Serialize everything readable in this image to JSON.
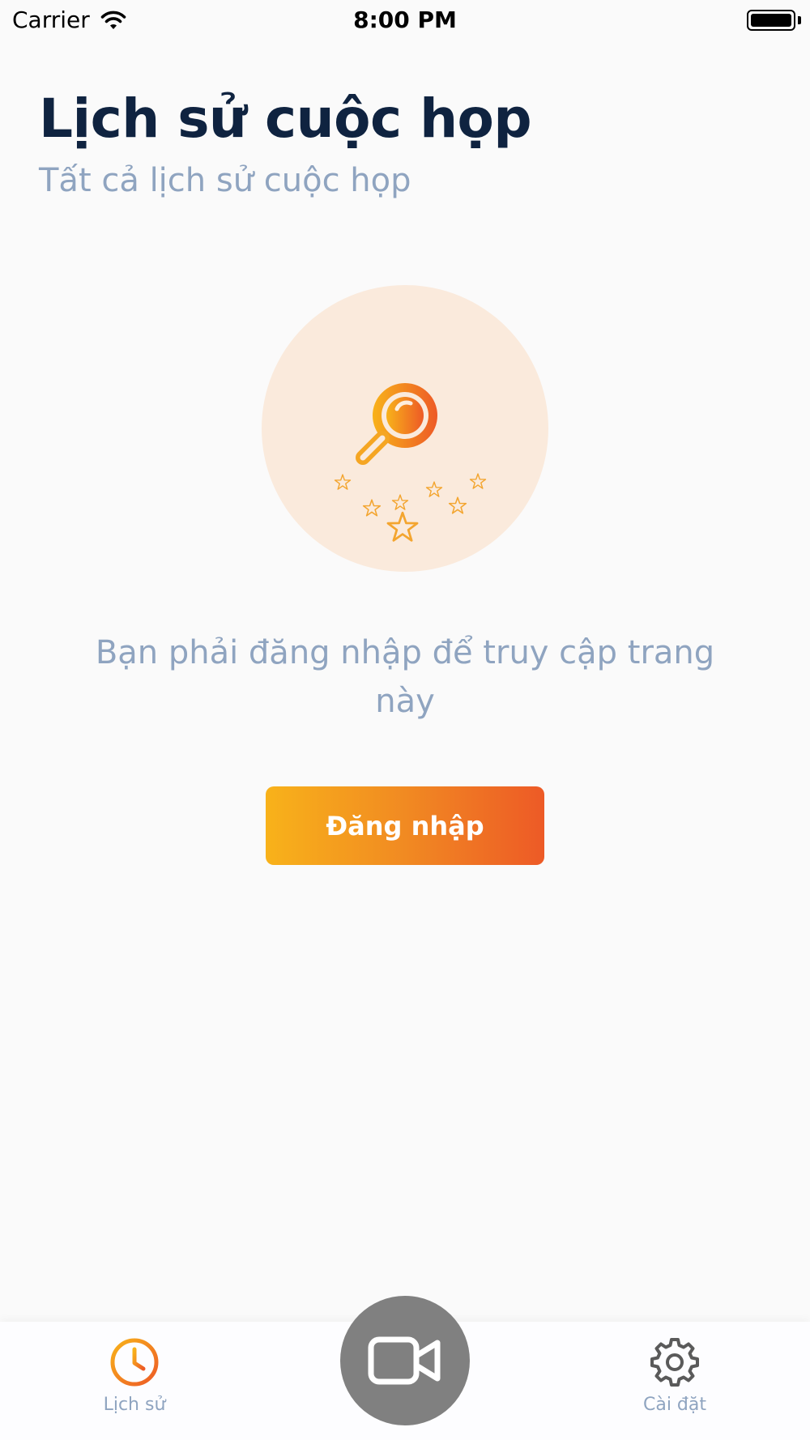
{
  "status_bar": {
    "carrier": "Carrier",
    "time": "8:00 PM",
    "wifi_icon": "wifi-icon",
    "battery_icon": "battery-icon",
    "battery_level": 1.0
  },
  "header": {
    "title": "Lịch sử cuộc họp",
    "subtitle": "Tất cả lịch sử cuộc họp"
  },
  "empty_state": {
    "illustration_icon": "magnifier-stars-icon",
    "message": "Bạn phải đăng nhập để truy cập trang này",
    "login_label": "Đăng nhập"
  },
  "tab_bar": {
    "history": {
      "label": "Lịch sử",
      "icon": "clock-icon"
    },
    "center": {
      "icon": "video-camera-icon"
    },
    "settings": {
      "label": "Cài đặt",
      "icon": "gear-icon"
    }
  },
  "colors": {
    "accent_start": "#f8b21a",
    "accent_end": "#ed5a26",
    "title": "#0f2340",
    "muted": "#8fa4c0",
    "illustration_bg": "#faeadc",
    "center_button": "#808080",
    "background": "#fafafa"
  }
}
